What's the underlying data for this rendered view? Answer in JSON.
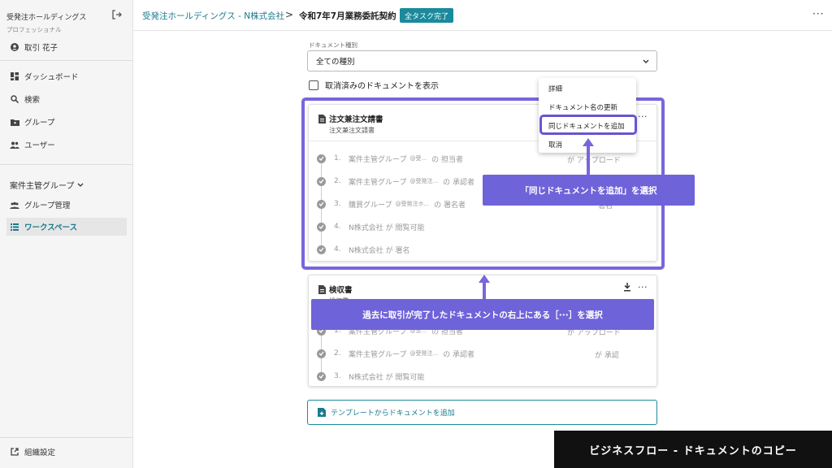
{
  "sidebar": {
    "org_name": "受発注ホールディングス",
    "plan": "プロフェッショナル",
    "user": "取引 花子",
    "nav": [
      "ダッシュボード",
      "検索",
      "グループ",
      "ユーザー"
    ],
    "group_title": "案件主管グループ",
    "group_nav": [
      "グループ管理",
      "ワークスペース"
    ],
    "settings": "組織設定"
  },
  "header": {
    "breadcrumb_link": "受発注ホールディングス - N株式会社",
    "breadcrumb_sep": ">",
    "current": "令和7年7月業務委託契約",
    "status": "全タスク完了",
    "more": "···"
  },
  "filter": {
    "label": "ドキュメント種別",
    "value": "全ての種別",
    "show_cancelled": "取消済みのドキュメントを表示"
  },
  "cards": [
    {
      "title": "注文兼注文請書",
      "subtitle": "注文兼注文請書",
      "tasks": [
        {
          "num": "1.",
          "text": "案件主管グループ",
          "small": "@受...",
          "tail": "の  担当者",
          "right": "が  アップロード"
        },
        {
          "num": "2.",
          "text": "案件主管グループ",
          "small": "@受発注...",
          "tail": "の  承認者",
          "right": ""
        },
        {
          "num": "3.",
          "text": "購買グループ",
          "small": "@受発注ホ...",
          "tail": "の  署名者",
          "right": "署名"
        },
        {
          "num": "4.",
          "text": "N株式会社  が  閲覧可能",
          "small": "",
          "tail": "",
          "right": ""
        },
        {
          "num": "4.",
          "text": "N株式会社  が  署名",
          "small": "",
          "tail": "",
          "right": ""
        }
      ]
    },
    {
      "title": "検収書",
      "subtitle": "検収書",
      "tasks": [
        {
          "num": "1.",
          "text": "案件主管グループ",
          "small": "@受...",
          "tail": "の  担当者",
          "right": "が  アップロード"
        },
        {
          "num": "2.",
          "text": "案件主管グループ",
          "small": "@受発注...",
          "tail": "の  承認者",
          "right": "が  承認"
        },
        {
          "num": "3.",
          "text": "N株式会社  が  閲覧可能",
          "small": "",
          "tail": "",
          "right": ""
        }
      ]
    }
  ],
  "add_template": "テンプレートからドキュメントを追加",
  "menu": {
    "items": [
      "詳細",
      "ドキュメント名の更新",
      "同じドキュメントを追加",
      "取消"
    ]
  },
  "annotations": {
    "callout_menu": "「同じドキュメントを追加」を選択",
    "callout_card": "過去に取引が完了したドキュメントの右上にある［···］を選択",
    "footer": "ビジネスフロー - ドキュメントのコピー"
  },
  "colors": {
    "accent": "#1a7a8c",
    "annotation": "#6f63d9",
    "badge": "#1a8a9c"
  }
}
